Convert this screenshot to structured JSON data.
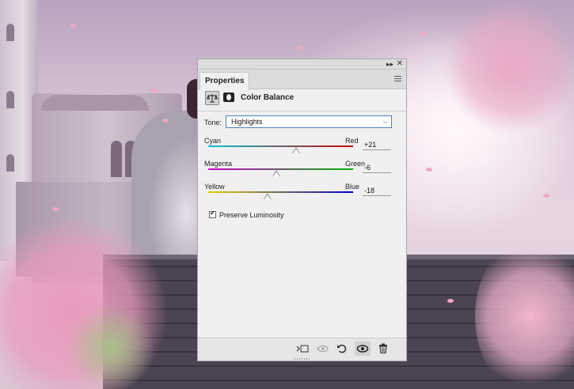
{
  "panel": {
    "tab_label": "Properties",
    "adjustment_title": "Color Balance",
    "icons": {
      "collapse": "double-chevron-right-icon",
      "close": "close-icon",
      "menu": "hamburger-menu-icon",
      "adjustment": "balance-scale-icon",
      "mask": "layer-mask-icon"
    },
    "tone": {
      "label": "Tone:",
      "selected": "Highlights"
    },
    "sliders": [
      {
        "left": "Cyan",
        "right": "Red",
        "value": "+21",
        "gradient": [
          "#00c6d8",
          "#d00000"
        ]
      },
      {
        "left": "Magenta",
        "right": "Green",
        "value": "-6",
        "gradient": [
          "#d000d0",
          "#00b400"
        ]
      },
      {
        "left": "Yellow",
        "right": "Blue",
        "value": "-18",
        "gradient": [
          "#e0d000",
          "#0000c8"
        ]
      }
    ],
    "preserve_luminosity": {
      "label": "Preserve Luminosity",
      "checked": true
    },
    "footer_icons": [
      "clip-to-layer-icon",
      "view-previous-state-icon",
      "reset-icon",
      "visibility-eye-icon",
      "trash-icon"
    ]
  }
}
